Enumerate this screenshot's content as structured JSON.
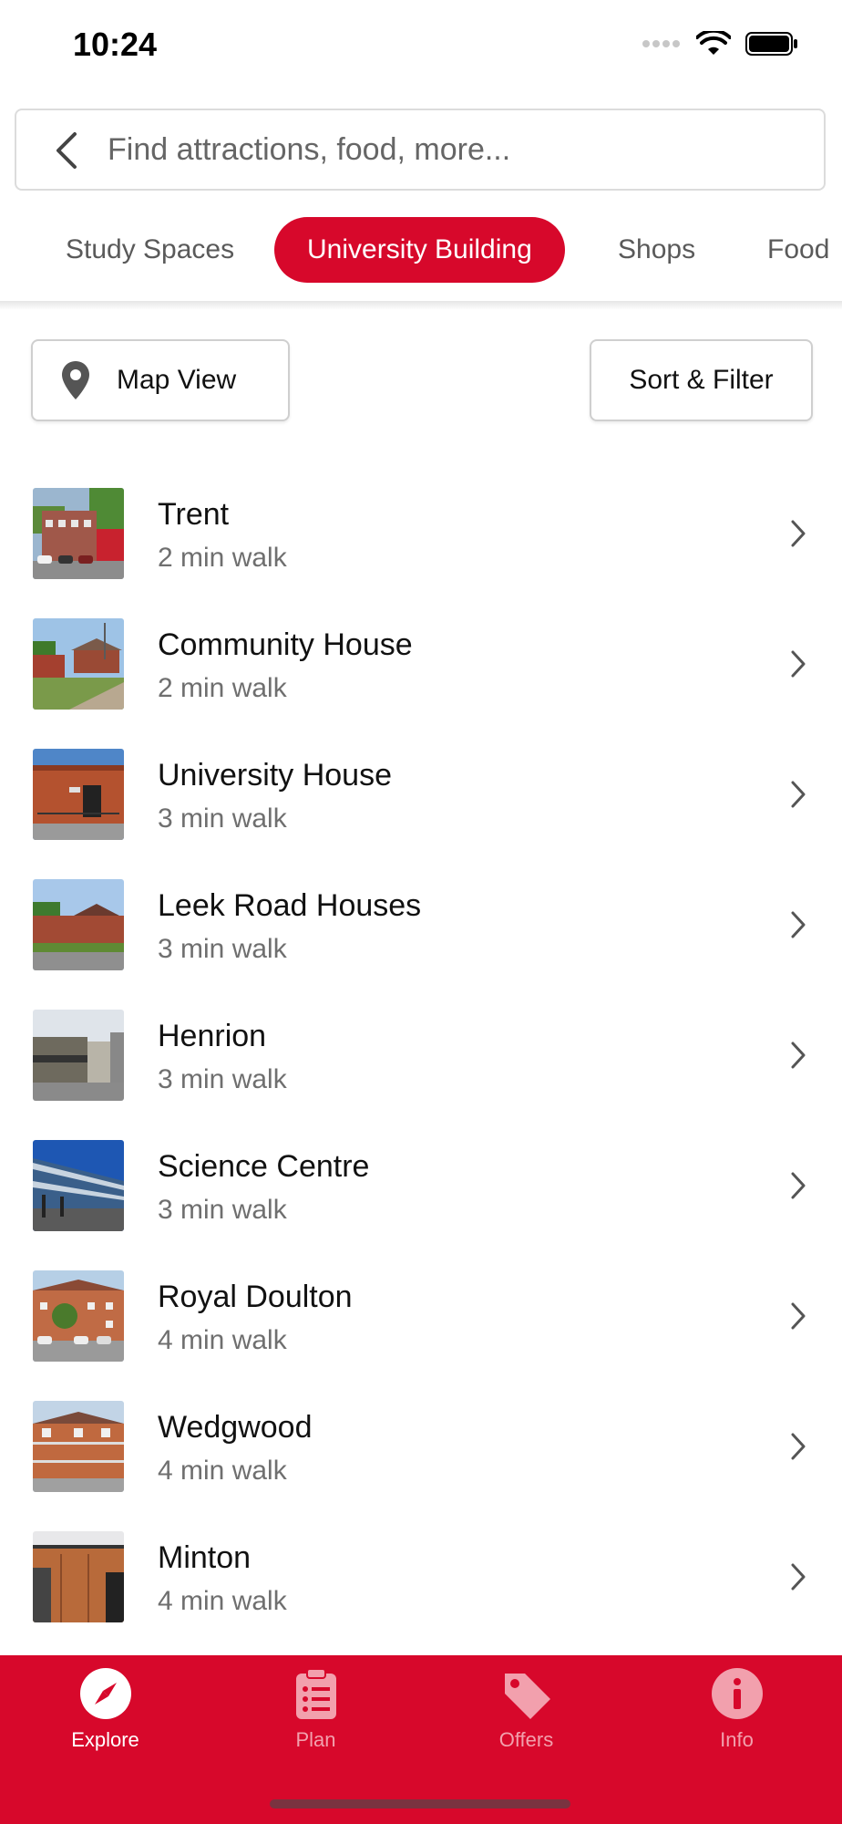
{
  "status_bar": {
    "time": "10:24"
  },
  "search": {
    "placeholder": "Find attractions, food, more..."
  },
  "categories": [
    {
      "label": "Study Spaces",
      "active": false
    },
    {
      "label": "University Building",
      "active": true
    },
    {
      "label": "Shops",
      "active": false
    },
    {
      "label": "Food",
      "active": false
    }
  ],
  "controls": {
    "map_view_label": "Map View",
    "sort_filter_label": "Sort & Filter"
  },
  "items": [
    {
      "title": "Trent",
      "subtitle": "2 min walk"
    },
    {
      "title": "Community House",
      "subtitle": "2 min walk"
    },
    {
      "title": "University House",
      "subtitle": "3 min walk"
    },
    {
      "title": "Leek Road Houses",
      "subtitle": "3 min walk"
    },
    {
      "title": "Henrion",
      "subtitle": "3 min walk"
    },
    {
      "title": "Science Centre",
      "subtitle": "3 min walk"
    },
    {
      "title": "Royal Doulton",
      "subtitle": "4 min walk"
    },
    {
      "title": "Wedgwood",
      "subtitle": "4 min walk"
    },
    {
      "title": "Minton",
      "subtitle": "4 min walk"
    }
  ],
  "tab_bar": [
    {
      "label": "Explore",
      "icon": "compass-icon",
      "selected": true
    },
    {
      "label": "Plan",
      "icon": "clipboard-icon",
      "selected": false
    },
    {
      "label": "Offers",
      "icon": "tag-icon",
      "selected": false
    },
    {
      "label": "Info",
      "icon": "info-icon",
      "selected": false
    }
  ],
  "colors": {
    "brand_red": "#d7082b",
    "subtitle_gray": "#6f6f6f",
    "inactive_tab": "#f2a0ad"
  }
}
